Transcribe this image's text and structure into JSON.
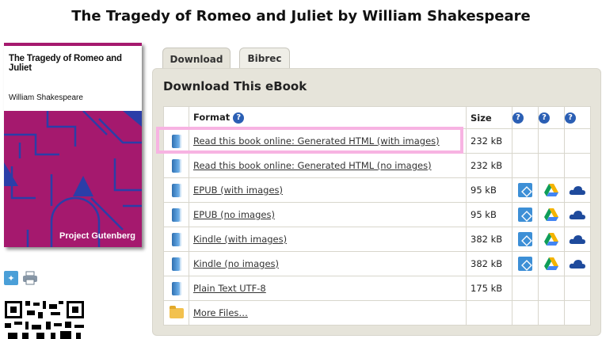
{
  "page": {
    "title": "The Tragedy of Romeo and Juliet by William Shakespeare"
  },
  "cover": {
    "title": "The Tragedy of Romeo and Juliet",
    "author": "William Shakespeare",
    "publisher": "Project Gutenberg",
    "accent": "#a5196e",
    "art_color": "#2b3ea8"
  },
  "tabs": [
    {
      "label": "Download",
      "active": true
    },
    {
      "label": "Bibrec",
      "active": false
    }
  ],
  "panel": {
    "heading": "Download This eBook",
    "columns": {
      "format": "Format",
      "size": "Size"
    },
    "rows": [
      {
        "icon": "book-icon",
        "format": "Read this book online: Generated HTML (with images)",
        "size": "232 kB",
        "services": false
      },
      {
        "icon": "book-icon",
        "format": "Read this book online: Generated HTML (no images)",
        "size": "232 kB",
        "services": false
      },
      {
        "icon": "book-icon",
        "format": "EPUB (with images)",
        "size": "95 kB",
        "services": true
      },
      {
        "icon": "book-icon",
        "format": "EPUB (no images)",
        "size": "95 kB",
        "services": true
      },
      {
        "icon": "book-icon",
        "format": "Kindle (with images)",
        "size": "382 kB",
        "services": true
      },
      {
        "icon": "book-icon",
        "format": "Kindle (no images)",
        "size": "382 kB",
        "services": true
      },
      {
        "icon": "book-icon",
        "format": "Plain Text UTF-8",
        "size": "175 kB",
        "services": false
      },
      {
        "icon": "folder-icon",
        "format": "More Files…",
        "size": "",
        "services": false
      }
    ]
  },
  "colors": {
    "panel_bg": "#e6e4da",
    "highlight": "#f7b3e2",
    "help_icon": "#2b5fb4"
  }
}
